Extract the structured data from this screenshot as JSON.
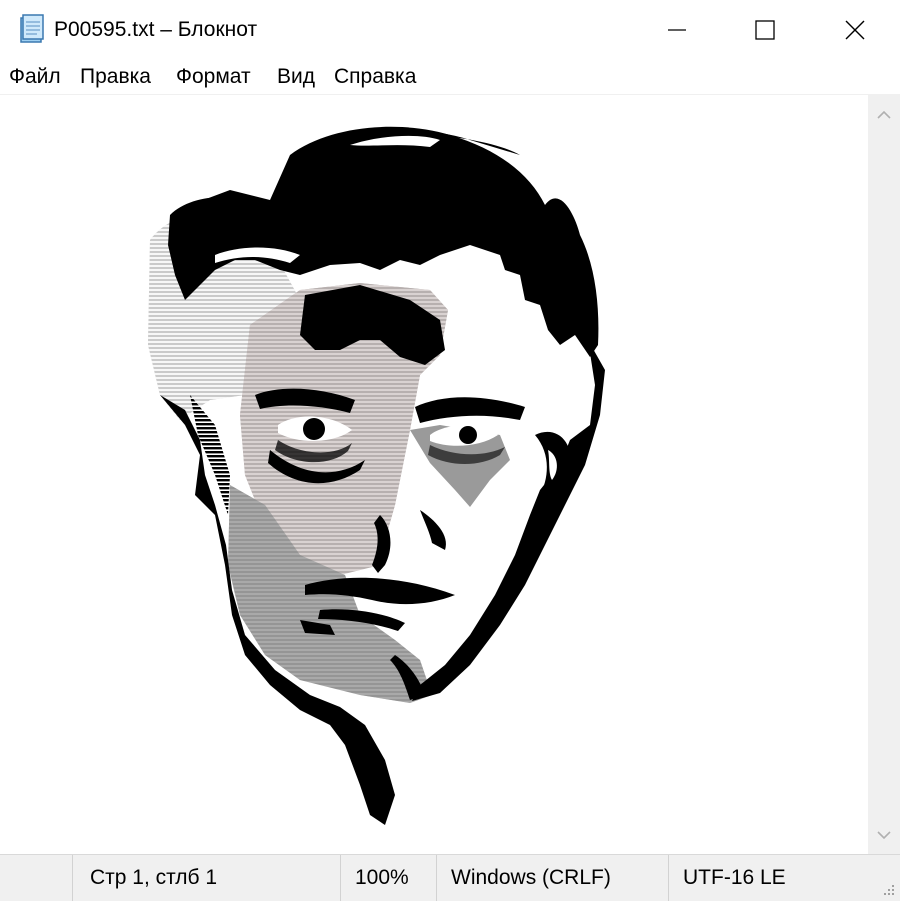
{
  "window": {
    "title": "P00595.txt – Блокнот",
    "icon": "notepad-icon",
    "controls": [
      "minimize-icon",
      "maximize-icon",
      "close-icon"
    ]
  },
  "menu": {
    "file": "Файл",
    "edit": "Правка",
    "format": "Формат",
    "view": "Вид",
    "help": "Справка"
  },
  "status": {
    "position": "Стр 1, стлб 1",
    "zoom": "100%",
    "line_endings": "Windows (CRLF)",
    "encoding": "UTF-16 LE"
  },
  "colors": {
    "skin_shadow": "#a08e8c",
    "skin_gray": "#7a7a7a",
    "hair_light": "#d8d8d8",
    "ink": "#000000"
  }
}
